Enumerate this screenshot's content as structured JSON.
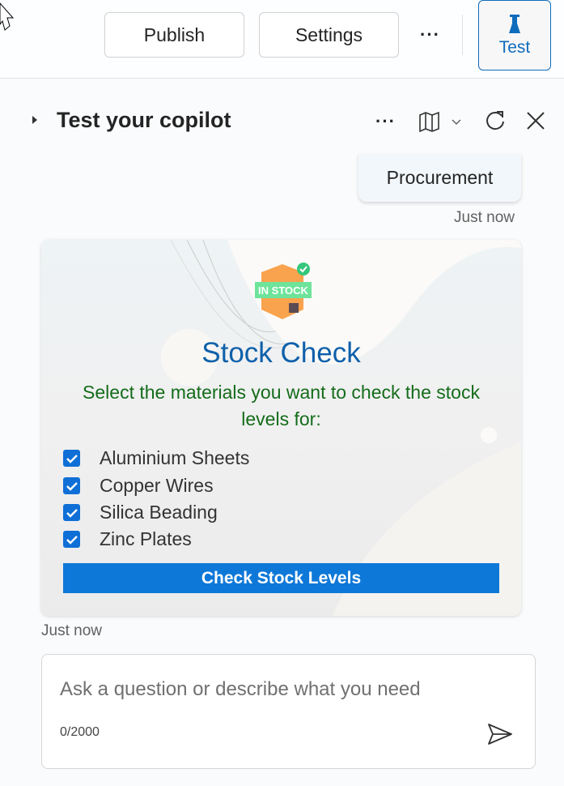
{
  "toolbar": {
    "publish": "Publish",
    "settings": "Settings",
    "more": "···",
    "test": "Test"
  },
  "panel": {
    "title": "Test your copilot",
    "more": "···"
  },
  "chat": {
    "user_message": "Procurement",
    "user_timestamp": "Just now",
    "card": {
      "logo_text": "IN STOCK",
      "title": "Stock Check",
      "subtitle": "Select the materials you want to check the stock levels for:",
      "options": [
        {
          "label": "Aluminium Sheets",
          "checked": true
        },
        {
          "label": "Copper Wires",
          "checked": true
        },
        {
          "label": "Silica Beading",
          "checked": true
        },
        {
          "label": "Zinc Plates",
          "checked": true
        }
      ],
      "action": "Check Stock Levels"
    },
    "bot_timestamp": "Just now"
  },
  "composer": {
    "placeholder": "Ask a question or describe what you need",
    "counter": "0/2000"
  },
  "colors": {
    "accent": "#0f6cbd",
    "card_title": "#0f60aa",
    "card_subtitle": "#146c1a",
    "button": "#0e78d8"
  }
}
